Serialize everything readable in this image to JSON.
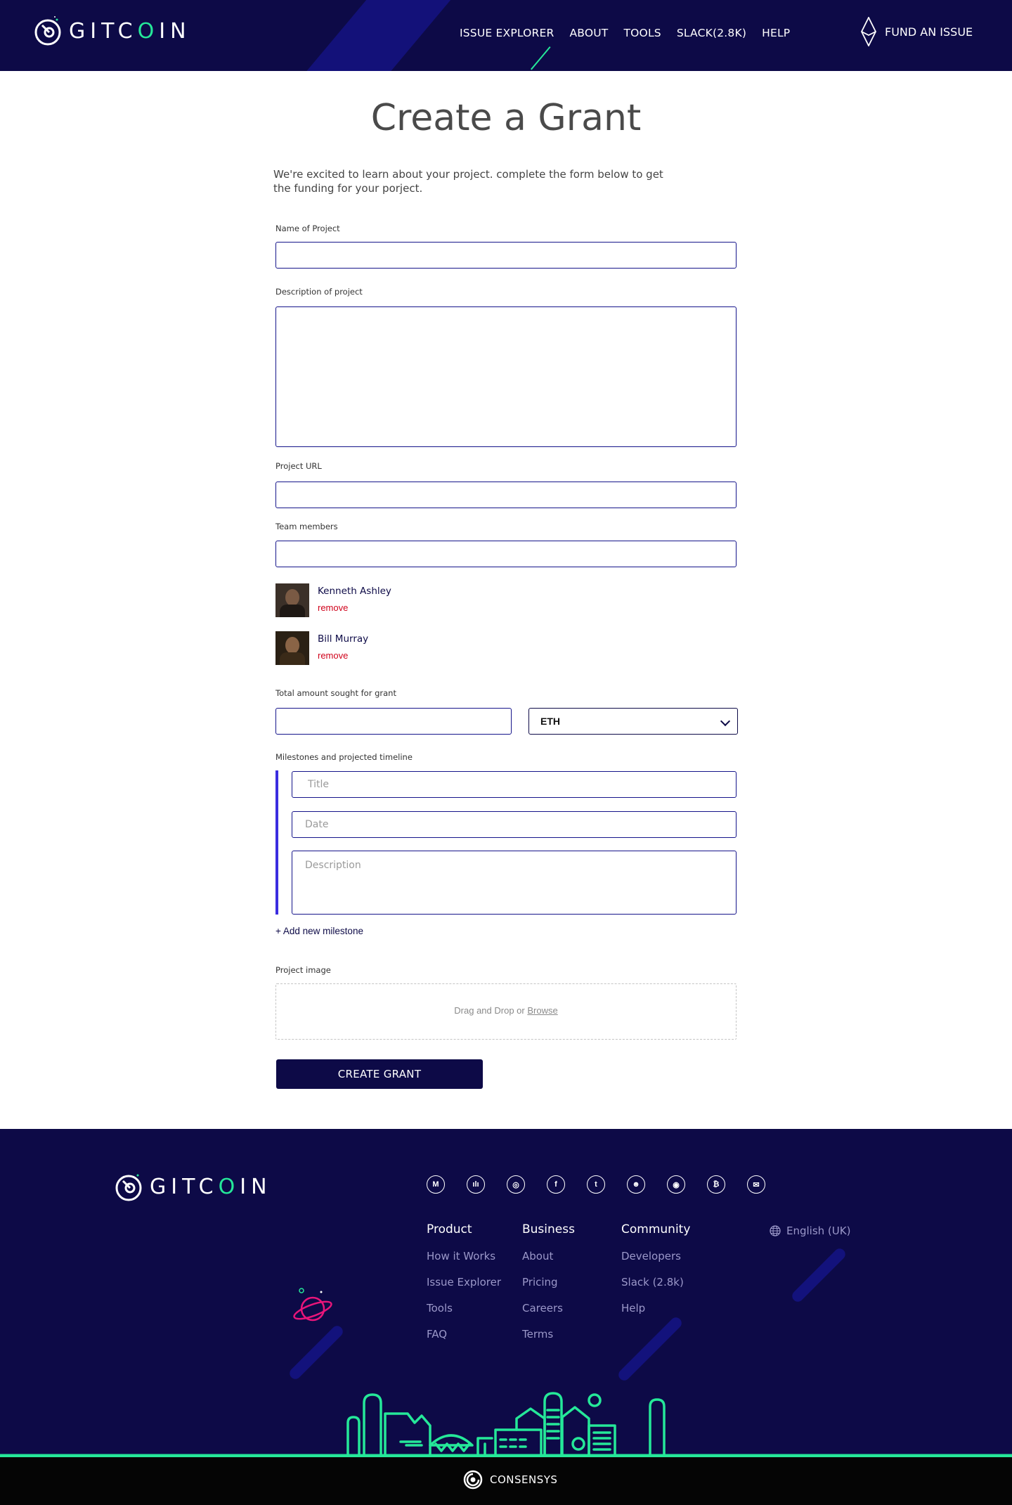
{
  "header": {
    "logo_text": "GITCOIN",
    "nav": [
      "ISSUE EXPLORER",
      "ABOUT",
      "TOOLS",
      "SLACK(2.8K)",
      "HELP"
    ],
    "fund_label": "FUND AN ISSUE"
  },
  "main": {
    "title": "Create a Grant",
    "intro": "We're excited to learn about your project. complete the form below to get the funding for your porject.",
    "labels": {
      "name": "Name of Project",
      "description": "Description of project",
      "url": "Project URL",
      "team": "Team members",
      "amount": "Total amount sought for grant",
      "milestones": "Milestones and projected timeline",
      "image": "Project image"
    },
    "team_members": [
      {
        "name": "Kenneth Ashley",
        "remove": "remove"
      },
      {
        "name": "Bill Murray",
        "remove": "remove"
      }
    ],
    "token": "ETH",
    "milestone_placeholders": {
      "title": "Title",
      "date": "Date",
      "description": "Description"
    },
    "add_milestone": "+ Add new milestone",
    "drop_text": "Drag and Drop or",
    "browse": "Browse",
    "create_button": "CREATE GRANT"
  },
  "footer": {
    "social": [
      "medium",
      "podcast",
      "github",
      "facebook",
      "twitter",
      "reddit",
      "discord",
      "bitcoin",
      "email"
    ],
    "columns": [
      {
        "heading": "Product",
        "items": [
          "How it Works",
          "Issue Explorer",
          "Tools",
          "FAQ"
        ]
      },
      {
        "heading": "Business",
        "items": [
          "About",
          "Pricing",
          "Careers",
          "Terms"
        ]
      },
      {
        "heading": "Community",
        "items": [
          "Developers",
          "Slack (2.8k)",
          "Help"
        ]
      }
    ],
    "language": "English (UK)",
    "consensys": "CONSENSYS"
  },
  "colors": {
    "navy": "#0d0a47",
    "green": "#25e899",
    "remove_red": "#d0021b",
    "milestone_bar": "#3b2de0"
  }
}
